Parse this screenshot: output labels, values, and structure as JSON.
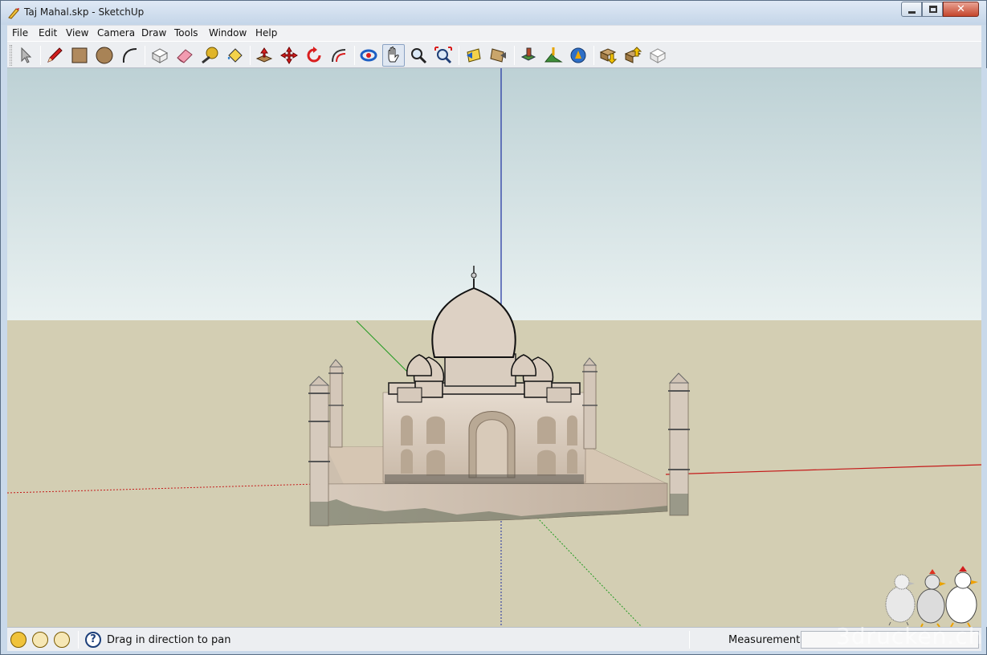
{
  "window": {
    "title": "Taj Mahal.skp - SketchUp",
    "close_glyph": "✕"
  },
  "menu": [
    "File",
    "Edit",
    "View",
    "Camera",
    "Draw",
    "Tools",
    "Window",
    "Help"
  ],
  "toolbar": {
    "tools": [
      {
        "name": "select-tool",
        "icon": "select-arrow-icon"
      },
      {
        "name": "line-tool",
        "icon": "pencil-icon"
      },
      {
        "name": "rectangle-tool",
        "icon": "rectangle-icon"
      },
      {
        "name": "circle-tool",
        "icon": "circle-icon"
      },
      {
        "name": "arc-tool",
        "icon": "arc-icon"
      },
      {
        "name": "make-component-tool",
        "icon": "component-icon"
      },
      {
        "name": "eraser-tool",
        "icon": "eraser-icon"
      },
      {
        "name": "tape-measure-tool",
        "icon": "tape-measure-icon"
      },
      {
        "name": "paint-bucket-tool",
        "icon": "paint-bucket-icon"
      },
      {
        "name": "push-pull-tool",
        "icon": "push-pull-icon"
      },
      {
        "name": "move-tool",
        "icon": "move-icon"
      },
      {
        "name": "rotate-tool",
        "icon": "rotate-icon"
      },
      {
        "name": "offset-tool",
        "icon": "offset-icon"
      },
      {
        "name": "orbit-tool",
        "icon": "orbit-icon"
      },
      {
        "name": "pan-tool",
        "icon": "hand-icon",
        "active": true
      },
      {
        "name": "zoom-tool",
        "icon": "magnifier-icon"
      },
      {
        "name": "zoom-extents-tool",
        "icon": "zoom-extents-icon"
      },
      {
        "name": "previous-view-tool",
        "icon": "previous-view-icon"
      },
      {
        "name": "next-view-tool",
        "icon": "next-view-icon"
      },
      {
        "name": "add-location-tool",
        "icon": "location-icon"
      },
      {
        "name": "toggle-terrain-tool",
        "icon": "terrain-icon"
      },
      {
        "name": "google-earth-tool",
        "icon": "globe-icon"
      },
      {
        "name": "get-models-tool",
        "icon": "get-models-icon"
      },
      {
        "name": "share-model-tool",
        "icon": "share-model-icon"
      },
      {
        "name": "extension-warehouse-tool",
        "icon": "warehouse-icon"
      }
    ]
  },
  "status": {
    "hint": "Drag in direction to pan",
    "measurements_label": "Measurements",
    "measurements_value": ""
  },
  "colors": {
    "sky_top": "#bdd1d5",
    "sky_bottom": "#e9f1f1",
    "ground": "#d3ceb3",
    "axis_red": "#c41a1a",
    "axis_green": "#1f9a1f",
    "axis_blue": "#1c2fa0"
  },
  "watermark": "3drucken.ch"
}
